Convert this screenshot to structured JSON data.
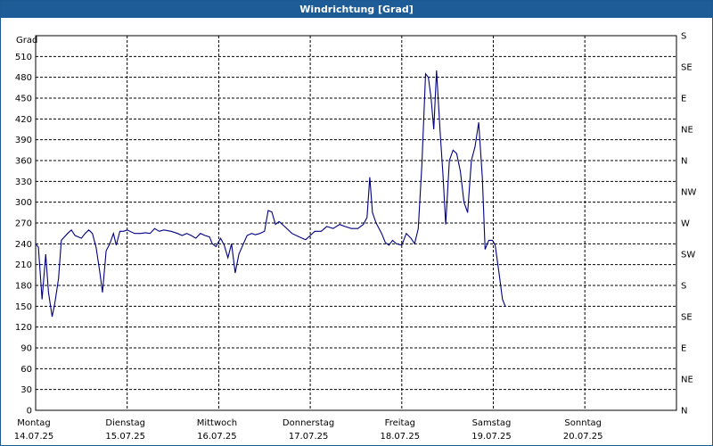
{
  "window": {
    "title": "Windrichtung [Grad]"
  },
  "chart_data": {
    "type": "line",
    "title": "Windrichtung [Grad]",
    "ylabel": "Grad",
    "ylim": [
      0,
      540
    ],
    "y_ticks": [
      0,
      30,
      60,
      90,
      120,
      150,
      180,
      210,
      240,
      270,
      300,
      330,
      360,
      390,
      420,
      450,
      480,
      510
    ],
    "y2_ticks": [
      {
        "value": 0,
        "label": "N"
      },
      {
        "value": 45,
        "label": "NE"
      },
      {
        "value": 90,
        "label": "E"
      },
      {
        "value": 135,
        "label": "SE"
      },
      {
        "value": 180,
        "label": "S"
      },
      {
        "value": 225,
        "label": "SW"
      },
      {
        "value": 270,
        "label": "W"
      },
      {
        "value": 315,
        "label": "NW"
      },
      {
        "value": 360,
        "label": "N"
      },
      {
        "value": 405,
        "label": "NE"
      },
      {
        "value": 450,
        "label": "E"
      },
      {
        "value": 495,
        "label": "SE"
      },
      {
        "value": 540,
        "label": "S"
      }
    ],
    "xlim": [
      0,
      7
    ],
    "x_ticks": [
      {
        "day": 0,
        "weekday": "Montag",
        "date": "14.07.25"
      },
      {
        "day": 1,
        "weekday": "Dienstag",
        "date": "15.07.25"
      },
      {
        "day": 2,
        "weekday": "Mittwoch",
        "date": "16.07.25"
      },
      {
        "day": 3,
        "weekday": "Donnerstag",
        "date": "17.07.25"
      },
      {
        "day": 4,
        "weekday": "Freitag",
        "date": "18.07.25"
      },
      {
        "day": 5,
        "weekday": "Samstag",
        "date": "19.07.25"
      },
      {
        "day": 6,
        "weekday": "Sonntag",
        "date": "20.07.25"
      }
    ],
    "grid": true,
    "line_color": "#000080",
    "series": [
      {
        "name": "",
        "points": [
          [
            0.0,
            240
          ],
          [
            0.03,
            235
          ],
          [
            0.07,
            160
          ],
          [
            0.11,
            225
          ],
          [
            0.14,
            170
          ],
          [
            0.18,
            135
          ],
          [
            0.21,
            155
          ],
          [
            0.25,
            190
          ],
          [
            0.28,
            245
          ],
          [
            0.35,
            255
          ],
          [
            0.39,
            260
          ],
          [
            0.43,
            252
          ],
          [
            0.5,
            248
          ],
          [
            0.54,
            255
          ],
          [
            0.58,
            260
          ],
          [
            0.62,
            255
          ],
          [
            0.66,
            235
          ],
          [
            0.7,
            200
          ],
          [
            0.73,
            170
          ],
          [
            0.77,
            230
          ],
          [
            0.81,
            240
          ],
          [
            0.85,
            255
          ],
          [
            0.88,
            238
          ],
          [
            0.92,
            258
          ],
          [
            0.96,
            258
          ],
          [
            1.0,
            260
          ],
          [
            1.08,
            255
          ],
          [
            1.15,
            255
          ],
          [
            1.2,
            256
          ],
          [
            1.25,
            255
          ],
          [
            1.3,
            262
          ],
          [
            1.35,
            258
          ],
          [
            1.4,
            260
          ],
          [
            1.48,
            258
          ],
          [
            1.55,
            255
          ],
          [
            1.6,
            252
          ],
          [
            1.65,
            255
          ],
          [
            1.7,
            252
          ],
          [
            1.75,
            248
          ],
          [
            1.8,
            255
          ],
          [
            1.85,
            252
          ],
          [
            1.9,
            250
          ],
          [
            1.93,
            240
          ],
          [
            1.97,
            236
          ],
          [
            2.02,
            248
          ],
          [
            2.06,
            238
          ],
          [
            2.1,
            220
          ],
          [
            2.14,
            240
          ],
          [
            2.18,
            198
          ],
          [
            2.22,
            225
          ],
          [
            2.27,
            240
          ],
          [
            2.31,
            252
          ],
          [
            2.36,
            255
          ],
          [
            2.4,
            253
          ],
          [
            2.45,
            255
          ],
          [
            2.5,
            258
          ],
          [
            2.54,
            288
          ],
          [
            2.58,
            286
          ],
          [
            2.62,
            268
          ],
          [
            2.66,
            272
          ],
          [
            2.72,
            265
          ],
          [
            2.8,
            255
          ],
          [
            2.88,
            250
          ],
          [
            2.95,
            246
          ],
          [
            3.0,
            252
          ],
          [
            3.05,
            258
          ],
          [
            3.12,
            258
          ],
          [
            3.18,
            265
          ],
          [
            3.25,
            262
          ],
          [
            3.32,
            268
          ],
          [
            3.38,
            265
          ],
          [
            3.45,
            262
          ],
          [
            3.52,
            262
          ],
          [
            3.58,
            268
          ],
          [
            3.62,
            278
          ],
          [
            3.65,
            336
          ],
          [
            3.68,
            285
          ],
          [
            3.72,
            270
          ],
          [
            3.78,
            255
          ],
          [
            3.82,
            242
          ],
          [
            3.86,
            238
          ],
          [
            3.9,
            245
          ],
          [
            3.94,
            240
          ],
          [
            4.0,
            238
          ],
          [
            4.05,
            255
          ],
          [
            4.1,
            248
          ],
          [
            4.14,
            240
          ],
          [
            4.18,
            262
          ],
          [
            4.22,
            355
          ],
          [
            4.26,
            485
          ],
          [
            4.29,
            480
          ],
          [
            4.32,
            450
          ],
          [
            4.35,
            405
          ],
          [
            4.38,
            490
          ],
          [
            4.42,
            400
          ],
          [
            4.45,
            340
          ],
          [
            4.48,
            268
          ],
          [
            4.52,
            360
          ],
          [
            4.56,
            375
          ],
          [
            4.6,
            370
          ],
          [
            4.64,
            345
          ],
          [
            4.68,
            300
          ],
          [
            4.72,
            285
          ],
          [
            4.76,
            360
          ],
          [
            4.8,
            380
          ],
          [
            4.84,
            415
          ],
          [
            4.88,
            335
          ],
          [
            4.91,
            232
          ],
          [
            4.95,
            245
          ],
          [
            4.99,
            245
          ],
          [
            5.02,
            238
          ],
          [
            5.06,
            200
          ],
          [
            5.1,
            160
          ],
          [
            5.13,
            150
          ]
        ]
      }
    ]
  }
}
